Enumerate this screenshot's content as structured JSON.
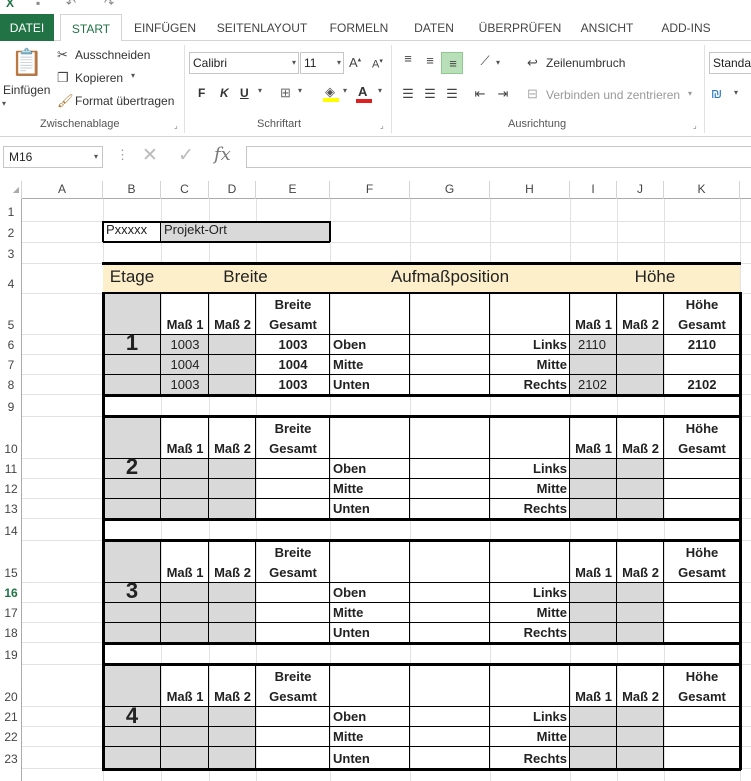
{
  "ribbon": {
    "tabs": [
      "DATEI",
      "START",
      "EINFÜGEN",
      "SEITENLAYOUT",
      "FORMELN",
      "DATEN",
      "ÜBERPRÜFEN",
      "ANSICHT",
      "ADD-INS"
    ],
    "clipboard": {
      "paste": "Einfügen",
      "cut": "Ausschneiden",
      "copy": "Kopieren",
      "format_painter": "Format übertragen",
      "group": "Zwischenablage"
    },
    "font": {
      "name": "Calibri",
      "size": "11",
      "bold": "F",
      "italic": "K",
      "underline": "U",
      "group": "Schriftart"
    },
    "alignment": {
      "wrap": "Zeilenumbruch",
      "merge": "Verbinden und zentrieren",
      "group": "Ausrichtung"
    },
    "number": {
      "format": "Standar"
    }
  },
  "formula_bar": {
    "name_box": "M16",
    "fx": "fx",
    "value": ""
  },
  "columns": [
    "A",
    "B",
    "C",
    "D",
    "E",
    "F",
    "G",
    "H",
    "I",
    "J",
    "K"
  ],
  "rows": [
    "1",
    "2",
    "3",
    "4",
    "5",
    "6",
    "7",
    "8",
    "9",
    "10",
    "11",
    "12",
    "13",
    "14",
    "15",
    "16",
    "17",
    "18",
    "19",
    "20",
    "21",
    "22",
    "23"
  ],
  "sheet": {
    "project_id": "Pxxxxx",
    "project_location": "Projekt-Ort",
    "headers": {
      "etage": "Etage",
      "breite": "Breite",
      "aufmass": "Aufmaßposition",
      "hoehe": "Höhe"
    },
    "sub": {
      "mass1": "Maß 1",
      "mass2": "Maß 2",
      "breite_gesamt_1": "Breite",
      "breite_gesamt_2": "Gesamt",
      "hoehe_gesamt_1": "Höhe",
      "hoehe_gesamt_2": "Gesamt"
    },
    "positions": {
      "oben": "Oben",
      "mitte": "Mitte",
      "unten": "Unten",
      "links": "Links",
      "rechts": "Rechts"
    },
    "floors": [
      {
        "label": "1",
        "rows": [
          {
            "m1": "1003",
            "m2": "",
            "bg": "1003",
            "pos": "Oben",
            "side": "Links",
            "h1": "2110",
            "h2": "",
            "hg": "2110"
          },
          {
            "m1": "1004",
            "m2": "",
            "bg": "1004",
            "pos": "Mitte",
            "side": "Mitte",
            "h1": "",
            "h2": "",
            "hg": ""
          },
          {
            "m1": "1003",
            "m2": "",
            "bg": "1003",
            "pos": "Unten",
            "side": "Rechts",
            "h1": "2102",
            "h2": "",
            "hg": "2102"
          }
        ]
      },
      {
        "label": "2",
        "rows": [
          {
            "m1": "",
            "m2": "",
            "bg": "",
            "pos": "Oben",
            "side": "Links",
            "h1": "",
            "h2": "",
            "hg": ""
          },
          {
            "m1": "",
            "m2": "",
            "bg": "",
            "pos": "Mitte",
            "side": "Mitte",
            "h1": "",
            "h2": "",
            "hg": ""
          },
          {
            "m1": "",
            "m2": "",
            "bg": "",
            "pos": "Unten",
            "side": "Rechts",
            "h1": "",
            "h2": "",
            "hg": ""
          }
        ]
      },
      {
        "label": "3",
        "rows": [
          {
            "m1": "",
            "m2": "",
            "bg": "",
            "pos": "Oben",
            "side": "Links",
            "h1": "",
            "h2": "",
            "hg": ""
          },
          {
            "m1": "",
            "m2": "",
            "bg": "",
            "pos": "Mitte",
            "side": "Mitte",
            "h1": "",
            "h2": "",
            "hg": ""
          },
          {
            "m1": "",
            "m2": "",
            "bg": "",
            "pos": "Unten",
            "side": "Rechts",
            "h1": "",
            "h2": "",
            "hg": ""
          }
        ]
      },
      {
        "label": "4",
        "rows": [
          {
            "m1": "",
            "m2": "",
            "bg": "",
            "pos": "Oben",
            "side": "Links",
            "h1": "",
            "h2": "",
            "hg": ""
          },
          {
            "m1": "",
            "m2": "",
            "bg": "",
            "pos": "Mitte",
            "side": "Mitte",
            "h1": "",
            "h2": "",
            "hg": ""
          },
          {
            "m1": "",
            "m2": "",
            "bg": "",
            "pos": "Unten",
            "side": "Rechts",
            "h1": "",
            "h2": "",
            "hg": ""
          }
        ]
      }
    ]
  },
  "selected_row": "16",
  "colors": {
    "accent": "#217346",
    "gray_fill": "#d9d9d9",
    "header_fill": "#fdefc9"
  }
}
